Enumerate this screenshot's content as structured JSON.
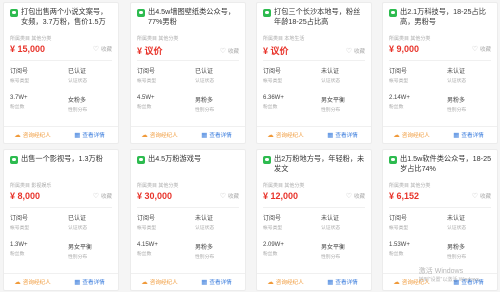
{
  "cards": [
    {
      "title": "打包出售两个小说文案号，女频，3.7万粉，售价1.5万",
      "meta": "所属类目  其他分类",
      "price": "¥ 15,000",
      "r1": [
        "订阅号",
        "已认证"
      ],
      "r1k": [
        "帐号类型",
        "认证状态"
      ],
      "r2": [
        "3.7W+",
        "女粉多"
      ],
      "r2k": [
        "粉丝数",
        "性别分布"
      ]
    },
    {
      "title": "出4.5w墙图壁纸类公众号，77%男粉",
      "meta": "所属类目  其他分类",
      "price": "¥ 议价",
      "r1": [
        "订阅号",
        "已认证"
      ],
      "r1k": [
        "帐号类型",
        "认证状态"
      ],
      "r2": [
        "4.5W+",
        "男粉多"
      ],
      "r2k": [
        "粉丝数",
        "性别分布"
      ]
    },
    {
      "title": "打包三个长沙本地号，粉丝年龄18-25占比高",
      "meta": "所属类目  本地生活",
      "price": "¥ 议价",
      "r1": [
        "订阅号",
        "未认证"
      ],
      "r1k": [
        "帐号类型",
        "认证状态"
      ],
      "r2": [
        "6.36W+",
        "男女平衡"
      ],
      "r2k": [
        "粉丝数",
        "性别分布"
      ]
    },
    {
      "title": "出2.1万科技号，18-25占比高，男粉号",
      "meta": "所属类目  其他分类",
      "price": "¥ 9,000",
      "r1": [
        "订阅号",
        "未认证"
      ],
      "r1k": [
        "帐号类型",
        "认证状态"
      ],
      "r2": [
        "2.14W+",
        "男粉多"
      ],
      "r2k": [
        "粉丝数",
        "性别分布"
      ]
    },
    {
      "title": "出售一个影视号，1.3万粉",
      "meta": "所属类目  影视娱乐",
      "price": "¥ 8,000",
      "r1": [
        "订阅号",
        "已认证"
      ],
      "r1k": [
        "帐号类型",
        "认证状态"
      ],
      "r2": [
        "1.3W+",
        "男女平衡"
      ],
      "r2k": [
        "粉丝数",
        "性别分布"
      ]
    },
    {
      "title": "出4.5万粉游戏号",
      "meta": "所属类目  其他分类",
      "price": "¥ 30,000",
      "r1": [
        "订阅号",
        "未认证"
      ],
      "r1k": [
        "帐号类型",
        "认证状态"
      ],
      "r2": [
        "4.15W+",
        "男粉多"
      ],
      "r2k": [
        "粉丝数",
        "性别分布"
      ]
    },
    {
      "title": "出2万粉地方号，年轻粉，未发文",
      "meta": "所属类目  其他分类",
      "price": "¥ 12,000",
      "r1": [
        "订阅号",
        "未认证"
      ],
      "r1k": [
        "帐号类型",
        "认证状态"
      ],
      "r2": [
        "2.09W+",
        "男女平衡"
      ],
      "r2k": [
        "粉丝数",
        "性别分布"
      ]
    },
    {
      "title": "出1.5w软件类公众号，18-25岁占比74%",
      "meta": "所属类目  其他分类",
      "price": "¥ 6,152",
      "r1": [
        "订阅号",
        "未认证"
      ],
      "r1k": [
        "帐号类型",
        "认证状态"
      ],
      "r2": [
        "1.53W+",
        "男粉多"
      ],
      "r2k": [
        "粉丝数",
        "性别分布"
      ]
    }
  ],
  "labels": {
    "favorite": "收藏",
    "consult": "咨询经纪人",
    "detail": "查看详情"
  },
  "watermark": {
    "line1": "激活 Windows",
    "line2": "转到\"设置\"以激活 Windows。"
  }
}
